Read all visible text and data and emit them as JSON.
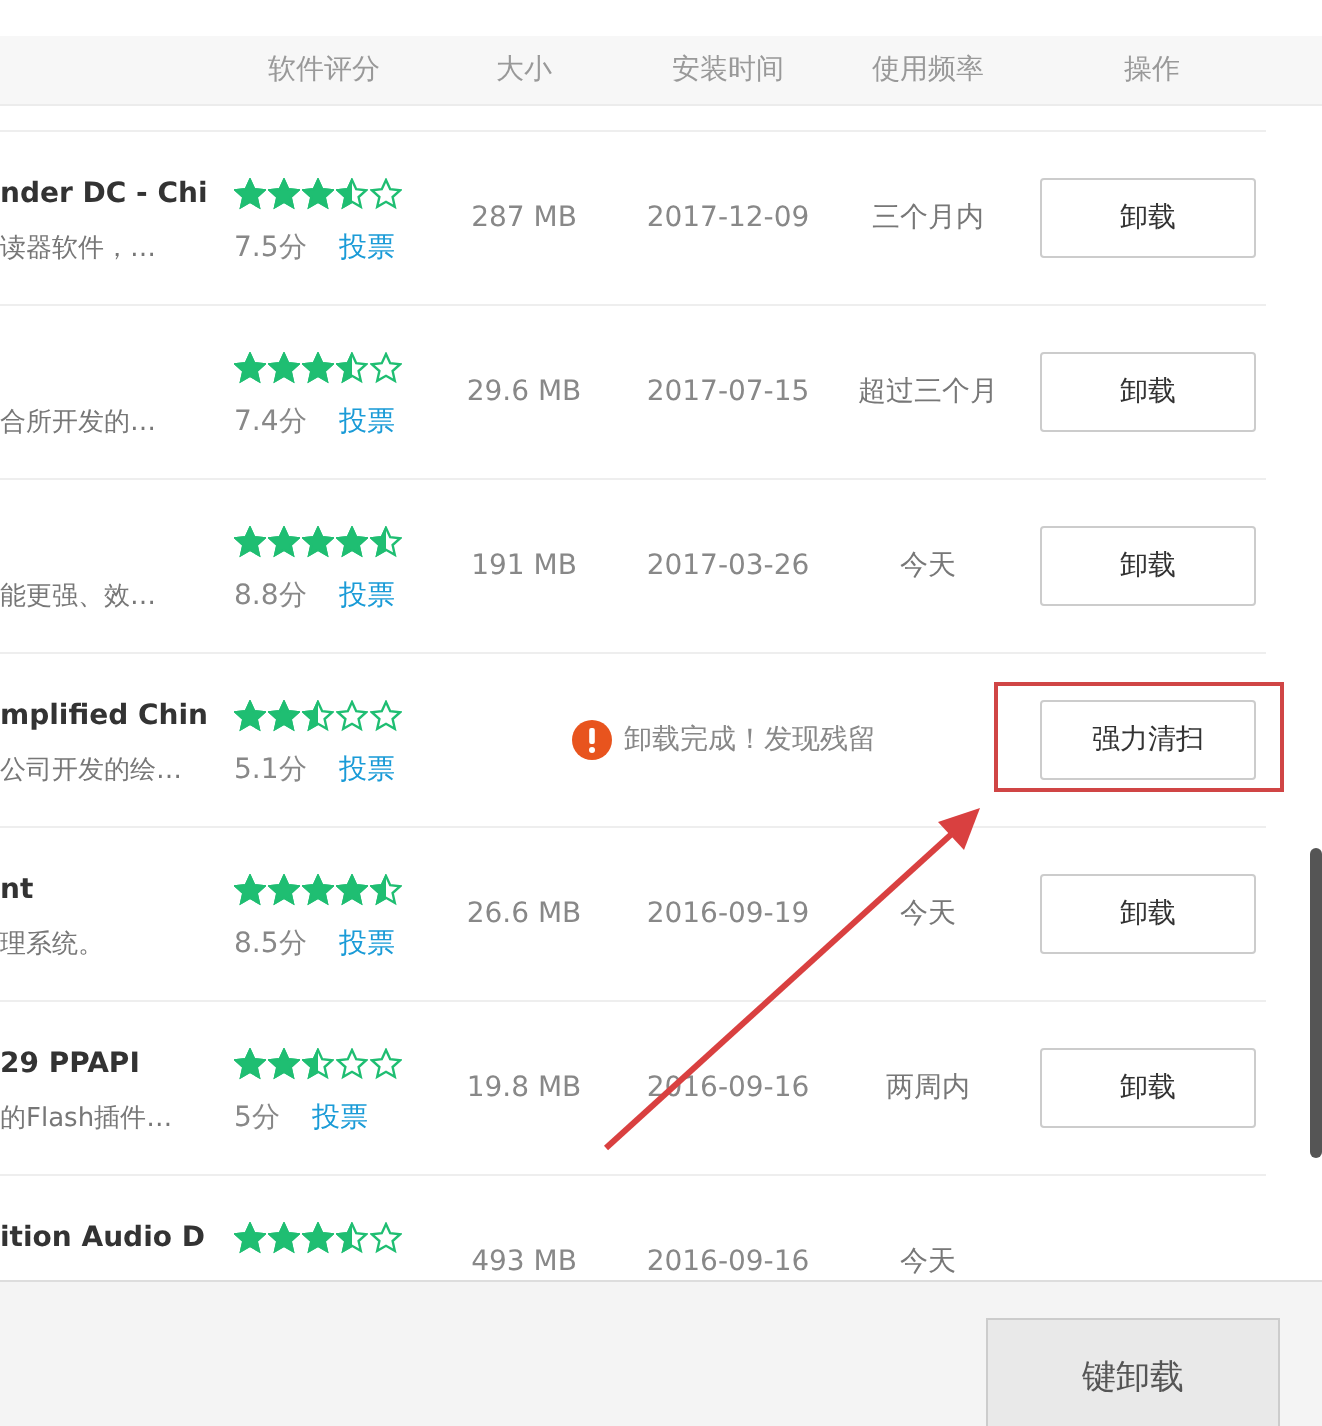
{
  "table": {
    "columns": [
      "软件评分",
      "大小",
      "安装时间",
      "使用频率",
      "操作"
    ],
    "rows": [
      {
        "kind": "normal",
        "name": "nder DC - Chi",
        "description": "读器软件，…",
        "stars": 3.5,
        "score": "7.5分",
        "vote": "投票",
        "size": "287 MB",
        "installed": "2017-12-09",
        "frequency": "三个月内",
        "action": "卸载",
        "highlighted": false
      },
      {
        "kind": "normal",
        "description": "合所开发的…",
        "stars": 3.5,
        "score": "7.4分",
        "vote": "投票",
        "size": "29.6 MB",
        "installed": "2017-07-15",
        "frequency": "超过三个月",
        "action": "卸载",
        "highlighted": false
      },
      {
        "kind": "normal",
        "description": "能更强、效…",
        "stars": 4.5,
        "score": "8.8分",
        "vote": "投票",
        "size": "191 MB",
        "installed": "2017-03-26",
        "frequency": "今天",
        "action": "卸载",
        "highlighted": false
      },
      {
        "kind": "residue",
        "name": "mplified Chin",
        "description": "公司开发的绘…",
        "stars": 2.5,
        "score": "5.1分",
        "vote": "投票",
        "message": "卸载完成！发现残留",
        "action": "强力清扫",
        "highlighted": true
      },
      {
        "kind": "normal",
        "name": "nt",
        "description": "理系统。",
        "stars": 4.5,
        "score": "8.5分",
        "vote": "投票",
        "size": "26.6 MB",
        "installed": "2016-09-19",
        "frequency": "今天",
        "action": "卸载",
        "highlighted": false
      },
      {
        "kind": "normal",
        "name": "29 PPAPI",
        "description": "的Flash插件…",
        "stars": 2.5,
        "score": "5分",
        "vote": "投票",
        "size": "19.8 MB",
        "installed": "2016-09-16",
        "frequency": "两周内",
        "action": "卸载",
        "highlighted": false
      },
      {
        "kind": "normal",
        "name": "ition Audio D",
        "stars": 3.5,
        "size": "493 MB",
        "installed": "2016-09-16",
        "frequency": "今天",
        "highlighted": false
      }
    ]
  },
  "footer_button": "键卸载"
}
